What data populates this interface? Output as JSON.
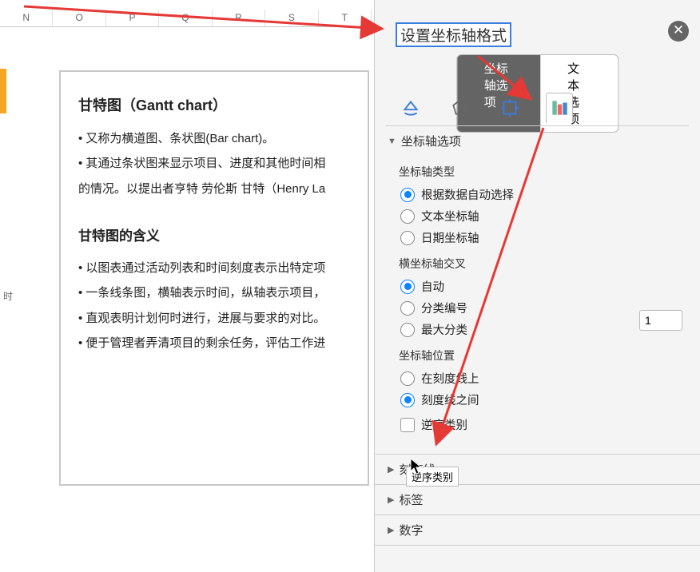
{
  "columns": [
    "N",
    "O",
    "P",
    "Q",
    "R",
    "S",
    "T"
  ],
  "sideLabel": "时",
  "doc": {
    "h1": "甘特图（Gantt chart）",
    "p1": "• 又称为横道图、条状图(Bar chart)。",
    "p2": "• 其通过条状图来显示项目、进度和其他时间相",
    "p3": "的情况。以提出者亨特 劳伦斯 甘特（Henry La",
    "h2": "甘特图的含义",
    "p4": "• 以图表通过活动列表和时间刻度表示出特定项",
    "p5": "• 一条线条图，横轴表示时间，纵轴表示项目，",
    "p6": "• 直观表明计划何时进行，进展与要求的对比。",
    "p7": "• 便于管理者弄清项目的剩余任务，评估工作进"
  },
  "panel": {
    "title": "设置坐标轴格式",
    "tab1": "坐标轴选项",
    "tab2": "文本选项",
    "sec_axis_options": "坐标轴选项",
    "axis_type_label": "坐标轴类型",
    "axis_type_opts": {
      "auto": "根据数据自动选择",
      "text": "文本坐标轴",
      "date": "日期坐标轴"
    },
    "cross_label": "横坐标轴交叉",
    "cross_opts": {
      "auto": "自动",
      "cat": "分类编号",
      "max": "最大分类"
    },
    "cross_value": "1",
    "pos_label": "坐标轴位置",
    "pos_opts": {
      "on": "在刻度线上",
      "between": "刻度线之间"
    },
    "reverse": "逆序类别",
    "tooltip": "逆序类别",
    "sec_tick": "刻度线",
    "sec_label": "标签",
    "sec_number": "数字"
  }
}
